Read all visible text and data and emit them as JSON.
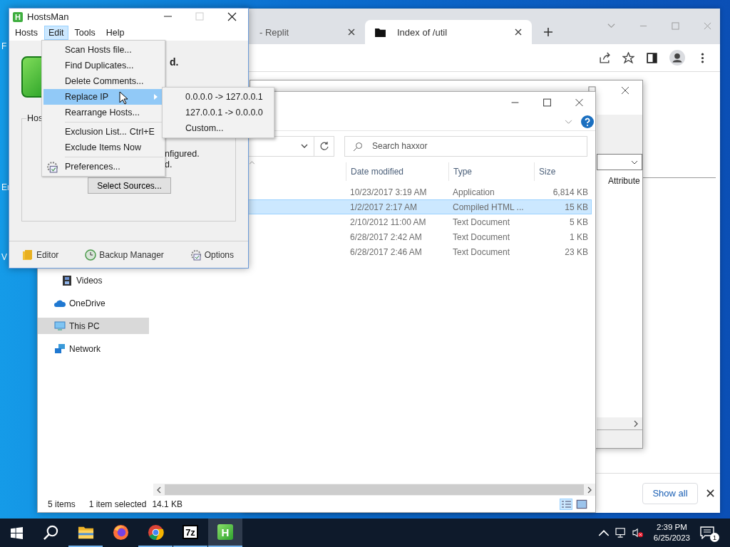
{
  "desktop": {
    "icon_labels": [
      "F",
      "Er",
      "V"
    ]
  },
  "browser": {
    "tabs": [
      {
        "title": "- Replit",
        "selected": false
      },
      {
        "title": "Index of /util",
        "selected": true
      }
    ],
    "download_bar": {
      "button": "Show all"
    }
  },
  "properties_dialog": {
    "column_header": "Attribute"
  },
  "explorer": {
    "search": {
      "placeholder": "Search haxxor"
    },
    "columns": [
      "Date modified",
      "Type",
      "Size"
    ],
    "rows": [
      {
        "date": "10/23/2017 3:19 AM",
        "type": "Application",
        "size": "6,814 KB",
        "selected": false
      },
      {
        "date": "1/2/2017 2:17 AM",
        "type": "Compiled HTML ...",
        "size": "15 KB",
        "selected": true
      },
      {
        "date": "2/10/2012 11:00 AM",
        "type": "Text Document",
        "size": "5 KB",
        "selected": false
      },
      {
        "date": "6/28/2017 2:42 AM",
        "type": "Text Document",
        "size": "1 KB",
        "selected": false
      },
      {
        "date": "6/28/2017 2:46 AM",
        "type": "Text Document",
        "size": "23 KB",
        "selected": false
      }
    ],
    "nav": [
      {
        "label": "Videos",
        "kind": "subitem",
        "selected": false
      },
      {
        "label": "OneDrive",
        "kind": "root",
        "selected": false
      },
      {
        "label": "This PC",
        "kind": "root",
        "selected": true
      },
      {
        "label": "Network",
        "kind": "root",
        "selected": false
      }
    ],
    "status": {
      "count": "5 items",
      "selection": "1 item selected",
      "size": "14.1 KB"
    }
  },
  "hostsman": {
    "title": "HostsMan",
    "icon_letter": "H",
    "menu": [
      {
        "label": "Hosts",
        "selected": false
      },
      {
        "label": "Edit",
        "selected": true
      },
      {
        "label": "Tools",
        "selected": false
      },
      {
        "label": "Help",
        "selected": false
      }
    ],
    "heading_fragment": "d.",
    "group_label": "Hos",
    "lines": [
      "nfigured.",
      "d."
    ],
    "select_button": "Select Sources...",
    "footer_buttons": [
      {
        "label": "Editor"
      },
      {
        "label": "Backup Manager"
      },
      {
        "label": "Options"
      }
    ]
  },
  "edit_menu": {
    "items": [
      {
        "label": "Scan Hosts file...",
        "selected": false,
        "submenu": false,
        "separator_above": false
      },
      {
        "label": "Find Duplicates...",
        "selected": false,
        "submenu": false,
        "separator_above": false
      },
      {
        "label": "Delete Comments...",
        "selected": false,
        "submenu": false,
        "separator_above": false
      },
      {
        "label": "Replace IP",
        "selected": true,
        "submenu": true,
        "separator_above": false
      },
      {
        "label": "Rearrange Hosts...",
        "selected": false,
        "submenu": false,
        "separator_above": false
      },
      {
        "label": "Exclusion List...",
        "shortcut": "Ctrl+E",
        "selected": false,
        "submenu": false,
        "separator_above": true
      },
      {
        "label": "Exclude Items Now",
        "selected": false,
        "submenu": false,
        "separator_above": false
      },
      {
        "label": "Preferences...",
        "selected": false,
        "submenu": false,
        "separator_above": true
      }
    ]
  },
  "submenu": {
    "items": [
      "0.0.0.0 -> 127.0.0.1",
      "127.0.0.1 -> 0.0.0.0",
      "Custom..."
    ]
  },
  "taskbar": {
    "apps": [
      {
        "kind": "search",
        "running": false,
        "selected": false
      },
      {
        "kind": "explorer",
        "running": true,
        "selected": false
      },
      {
        "kind": "firefox",
        "running": false,
        "selected": false
      },
      {
        "kind": "chrome",
        "running": true,
        "selected": false
      },
      {
        "kind": "sevenzip",
        "label": "7z",
        "running": true,
        "selected": false
      },
      {
        "kind": "hostsman",
        "label": "H",
        "running": true,
        "selected": true
      }
    ],
    "time": "2:39 PM",
    "date": "6/25/2023",
    "notification_count": "1"
  }
}
